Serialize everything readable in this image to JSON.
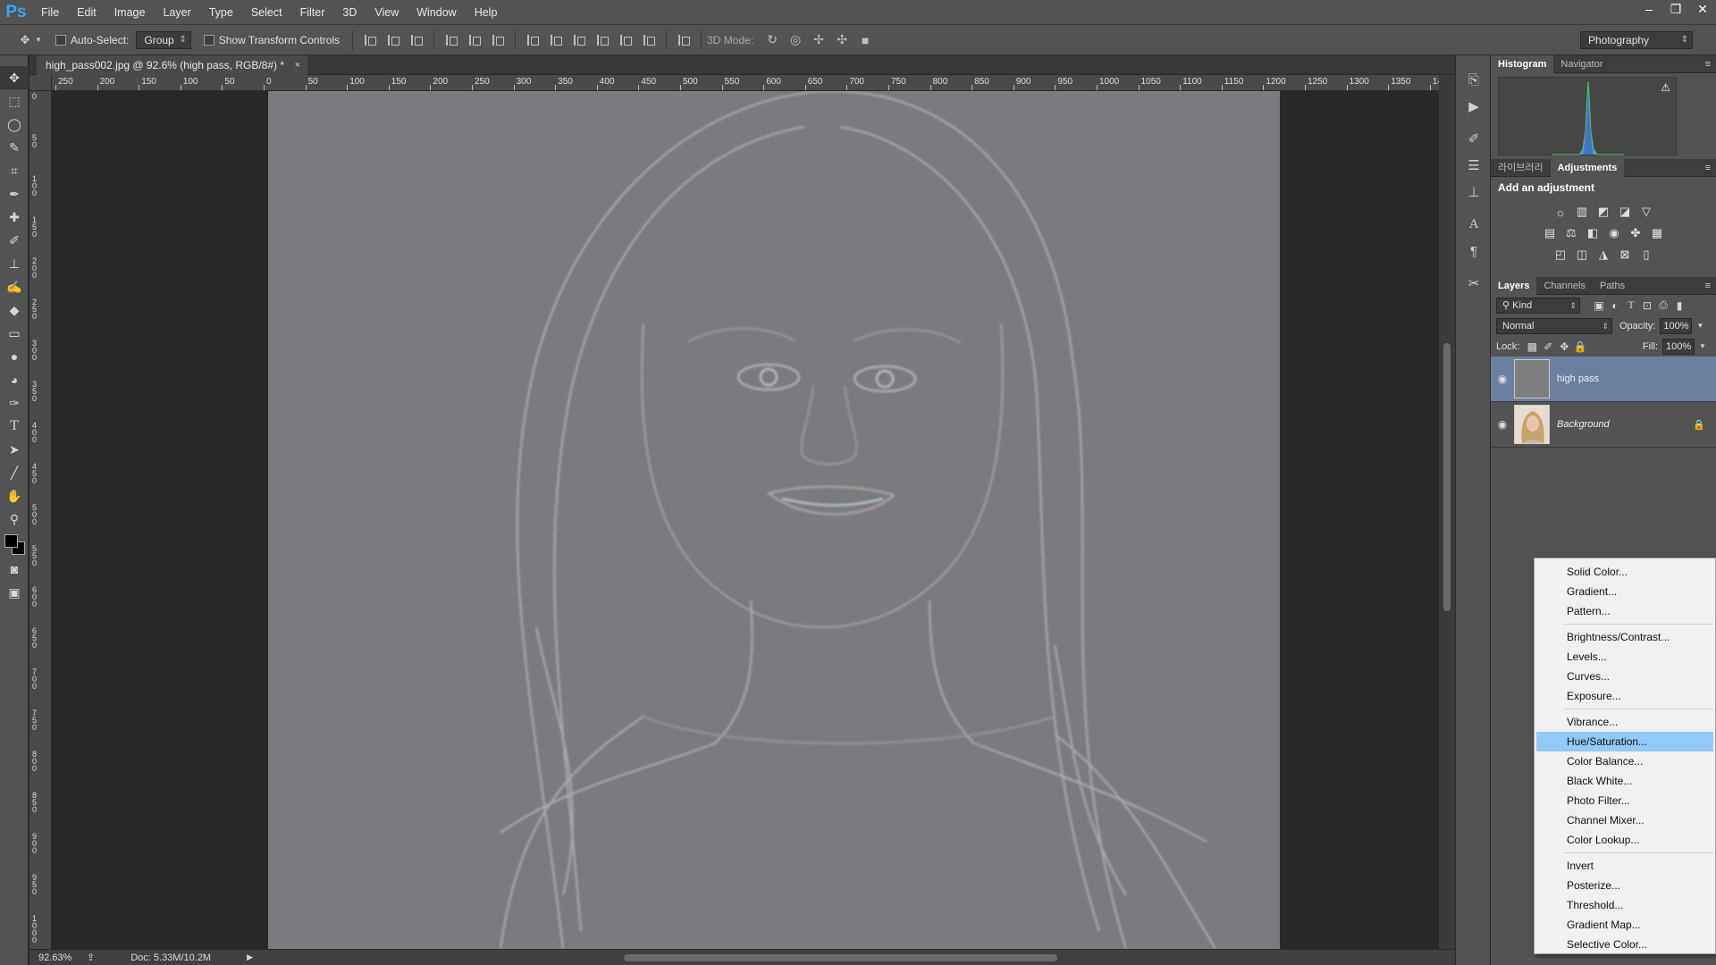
{
  "app": {
    "logo": "Ps",
    "menus": [
      "File",
      "Edit",
      "Image",
      "Layer",
      "Type",
      "Select",
      "Filter",
      "3D",
      "View",
      "Window",
      "Help"
    ],
    "window_controls": [
      "–",
      "❐",
      "✕"
    ]
  },
  "options_bar": {
    "auto_select_label": "Auto-Select:",
    "auto_select_value": "Group",
    "show_transform_label": "Show Transform Controls",
    "mode_label": "3D Mode:",
    "workspace": "Photography"
  },
  "document": {
    "tab_title": "high_pass002.jpg @ 92.6% (high pass, RGB/8#) *",
    "tab_close": "×",
    "ruler_top": [
      "250",
      "200",
      "150",
      "100",
      "50",
      "0",
      "50",
      "100",
      "150",
      "200",
      "250",
      "300",
      "350",
      "400",
      "450",
      "500",
      "550",
      "600",
      "650",
      "700",
      "750",
      "800",
      "850",
      "900",
      "950",
      "1000",
      "1050",
      "1100",
      "1150",
      "1200",
      "1250",
      "1300",
      "1350",
      "14"
    ],
    "ruler_left": [
      "0",
      "50",
      "100",
      "150",
      "200",
      "250",
      "300",
      "350",
      "400",
      "450",
      "500",
      "550",
      "600",
      "650",
      "700",
      "750",
      "800",
      "850",
      "900",
      "950",
      "1000"
    ]
  },
  "status": {
    "zoom": "92.63%",
    "doc": "Doc: 5.33M/10.2M"
  },
  "panels": {
    "histogram_tabs": [
      "Histogram",
      "Navigator"
    ],
    "histogram_warning": "⚠",
    "adjust_tabs": [
      "라이브러리",
      "Adjustments"
    ],
    "add_adjustment": "Add an adjustment",
    "layers_tabs": [
      "Layers",
      "Channels",
      "Paths"
    ],
    "filter_kind": "Kind",
    "blend_mode": "Normal",
    "opacity_label": "Opacity:",
    "opacity_value": "100%",
    "lock_label": "Lock:",
    "fill_label": "Fill:",
    "fill_value": "100%",
    "layers": [
      {
        "name": "high pass",
        "selected": true
      },
      {
        "name": "Background",
        "selected": false
      }
    ]
  },
  "adjustment_menu": {
    "groups": [
      [
        "Solid Color...",
        "Gradient...",
        "Pattern..."
      ],
      [
        "Brightness/Contrast...",
        "Levels...",
        "Curves...",
        "Exposure..."
      ],
      [
        "Vibrance...",
        "Hue/Saturation...",
        "Color Balance...",
        "Black  White...",
        "Photo Filter...",
        "Channel Mixer...",
        "Color Lookup..."
      ],
      [
        "Invert",
        "Posterize...",
        "Threshold...",
        "Gradient Map...",
        "Selective Color..."
      ]
    ],
    "highlighted": "Hue/Saturation..."
  },
  "colors": {
    "accent": "#31a8ff",
    "selection": "#6b7fa1",
    "menu_highlight": "#91c9f7",
    "image_gray": "#7a7b7e"
  }
}
